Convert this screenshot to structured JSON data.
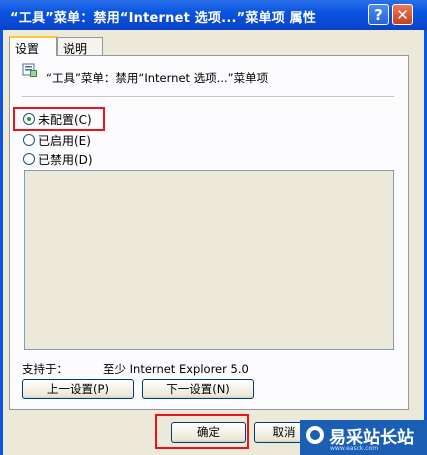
{
  "window": {
    "title": "“工具”菜单：禁用“Internet 选项...”菜单项 属性",
    "help_label": "?",
    "close_label": "✕"
  },
  "tabs": [
    {
      "label": "设置",
      "active": true
    },
    {
      "label": "说明",
      "active": false
    }
  ],
  "policy": {
    "icon": "policy-setting-icon",
    "title": "“工具”菜单：禁用“Internet 选项...”菜单项"
  },
  "options": [
    {
      "label": "未配置(C)",
      "checked": true
    },
    {
      "label": "已启用(E)",
      "checked": false
    },
    {
      "label": "已禁用(D)",
      "checked": false
    }
  ],
  "support": {
    "label": "支持于：",
    "value": "至少 Internet Explorer 5.0"
  },
  "buttons": {
    "prev": "上一设置(P)",
    "next": "下一设置(N)",
    "ok": "确定",
    "cancel": "取消"
  },
  "watermark": {
    "text": "易采站长站",
    "sub": "www.easck.com"
  },
  "colors": {
    "titlebar": "#0b55e0",
    "highlight": "#e8141c",
    "dialog_bg": "#ece9d8"
  }
}
